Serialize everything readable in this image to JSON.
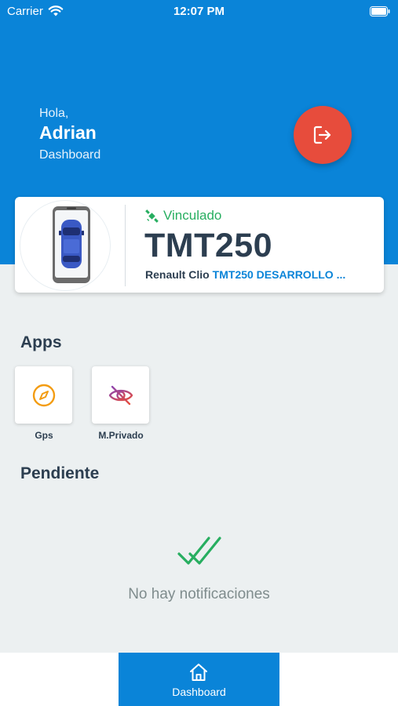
{
  "status_bar": {
    "carrier": "Carrier",
    "time": "12:07 PM"
  },
  "header": {
    "greeting": "Hola,",
    "user_name": "Adrian",
    "subtitle": "Dashboard",
    "logout_icon": "logout-icon"
  },
  "vehicle": {
    "status": "Vinculado",
    "status_icon": "satellite-icon",
    "plate": "TMT250",
    "model": "Renault Clio",
    "description": "TMT250 DESARROLLO ..."
  },
  "apps": {
    "title": "Apps",
    "items": [
      {
        "label": "Gps",
        "icon": "compass-icon"
      },
      {
        "label": "M.Privado",
        "icon": "eye-off-icon"
      }
    ]
  },
  "pending": {
    "title": "Pendiente",
    "empty_icon": "double-check-icon",
    "empty_text": "No hay notificaciones"
  },
  "tab_bar": {
    "items": [
      {
        "label": "Dashboard",
        "icon": "home-icon",
        "active": true
      }
    ]
  },
  "colors": {
    "primary": "#0a84d8",
    "logout": "#e74c3c",
    "linked": "#27ae60",
    "gps": "#f39c12",
    "private": "#c0392b",
    "text_dark": "#2c3e50"
  }
}
